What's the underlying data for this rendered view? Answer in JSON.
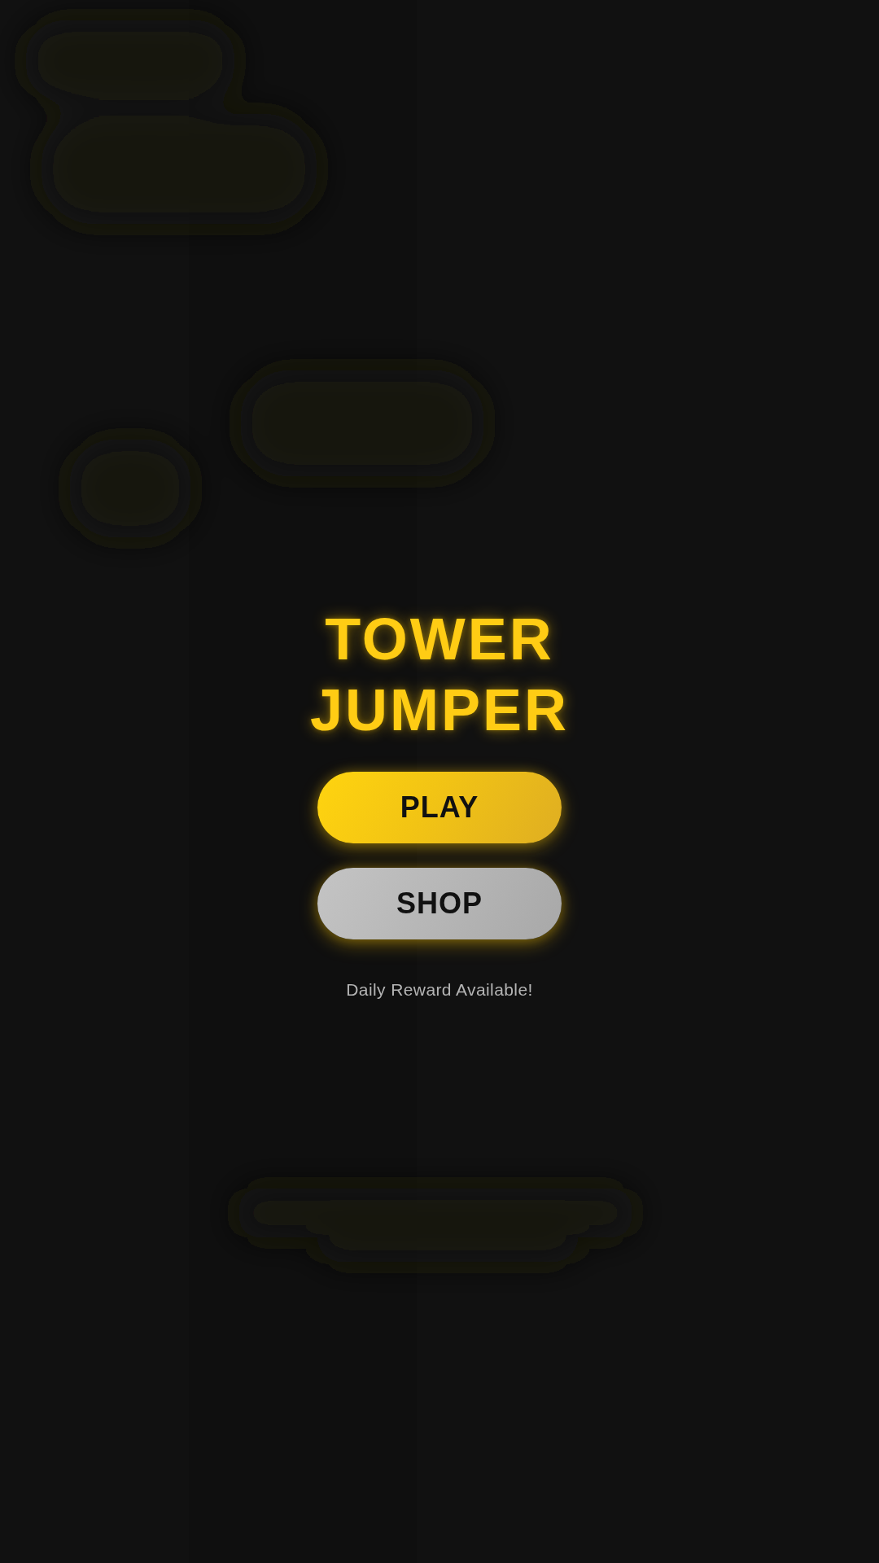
{
  "title": "TOWER JUMPER",
  "buttons": [
    {
      "label": "PLAY",
      "kind": "primary"
    },
    {
      "label": "SHOP",
      "kind": "secondary"
    }
  ],
  "notice": "Daily Reward Available!"
}
